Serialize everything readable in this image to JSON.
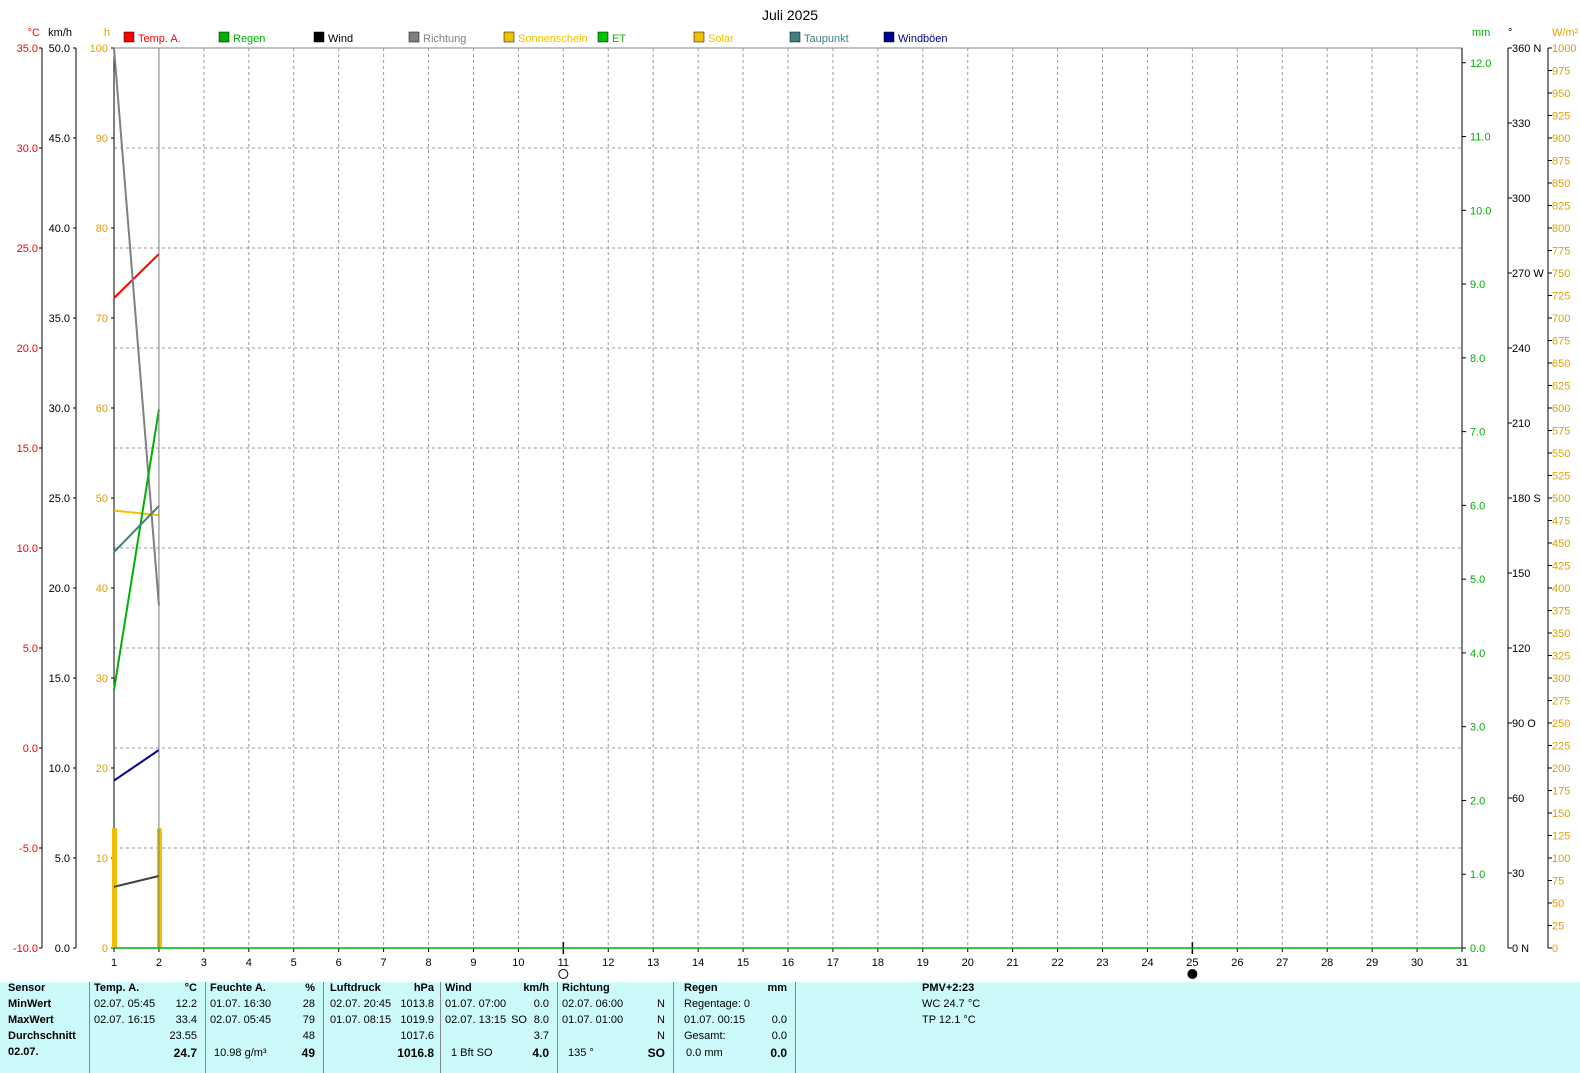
{
  "title": "Juli 2025",
  "units": {
    "temp": "°C",
    "wind": "km/h",
    "hours": "h",
    "rain": "mm",
    "dir": "°",
    "solar": "W/m²"
  },
  "legend": [
    {
      "label": "Temp. A.",
      "color": "#ff0000"
    },
    {
      "label": "Regen",
      "color": "#00b000"
    },
    {
      "label": "Wind",
      "color": "#000000"
    },
    {
      "label": "Richtung",
      "color": "#808080"
    },
    {
      "label": "Sonnenschein",
      "color": "#f0c000"
    },
    {
      "label": "ET",
      "color": "#00c000"
    },
    {
      "label": "Solar",
      "color": "#f0c000"
    },
    {
      "label": "Taupunkt",
      "color": "#408080"
    },
    {
      "label": "Windböen",
      "color": "#000090"
    }
  ],
  "chart_data": {
    "type": "line",
    "title": "Juli 2025",
    "x_ticks": [
      "1",
      "2",
      "3",
      "4",
      "5",
      "6",
      "7",
      "8",
      "9",
      "10",
      "11",
      "12",
      "13",
      "14",
      "15",
      "16",
      "17",
      "18",
      "19",
      "20",
      "21",
      "22",
      "23",
      "24",
      "25",
      "26",
      "27",
      "28",
      "29",
      "30",
      "31"
    ],
    "xlim": [
      1,
      31
    ],
    "grid": true,
    "axes": {
      "temp": {
        "unit": "°C",
        "ylim": [
          -10,
          35
        ],
        "ticks": [
          "35.0",
          "30.0",
          "25.0",
          "20.0",
          "15.0",
          "10.0",
          "5.0",
          "0.0",
          "-5.0",
          "-10.0"
        ],
        "color": "#ff0000"
      },
      "wind": {
        "unit": "km/h",
        "ylim": [
          0,
          50
        ],
        "ticks": [
          "50.0",
          "45.0",
          "40.0",
          "35.0",
          "30.0",
          "25.0",
          "20.0",
          "15.0",
          "10.0",
          "5.0",
          "0.0"
        ],
        "color": "#000000"
      },
      "hours": {
        "unit": "h",
        "ylim": [
          0,
          100
        ],
        "ticks": [
          "100",
          "90",
          "80",
          "70",
          "60",
          "50",
          "40",
          "30",
          "20",
          "10",
          "0"
        ],
        "color": "#e0a000"
      },
      "rain": {
        "unit": "mm",
        "ylim": [
          0,
          12.2
        ],
        "ticks": [
          "12.0",
          "11.0",
          "10.0",
          "9.0",
          "8.0",
          "7.0",
          "6.0",
          "5.0",
          "4.0",
          "3.0",
          "2.0",
          "1.0",
          "0.0"
        ],
        "color": "#00b000"
      },
      "direction": {
        "unit": "°",
        "ylim": [
          0,
          360
        ],
        "ticks": [
          "360 N",
          "330",
          "300",
          "270 W",
          "240",
          "210",
          "180 S",
          "150",
          "120",
          "90 O",
          "60",
          "30",
          "0 N"
        ],
        "color": "#000000"
      },
      "solar": {
        "unit": "W/m²",
        "ylim": [
          0,
          1000
        ],
        "ticks": [
          "1000",
          "975",
          "950",
          "925",
          "900",
          "875",
          "850",
          "825",
          "800",
          "775",
          "750",
          "725",
          "700",
          "675",
          "650",
          "625",
          "600",
          "575",
          "550",
          "525",
          "500",
          "475",
          "450",
          "425",
          "400",
          "375",
          "350",
          "325",
          "300",
          "275",
          "250",
          "225",
          "200",
          "175",
          "150",
          "125",
          "100",
          "75",
          "50",
          "25",
          "0"
        ],
        "color": "#e0a000"
      }
    },
    "series": [
      {
        "name": "Temp. A.",
        "axis": "temp",
        "color": "#ff0000",
        "x": [
          1,
          2
        ],
        "y": [
          22.5,
          24.7
        ]
      },
      {
        "name": "Regen",
        "axis": "rain",
        "color": "#00b000",
        "x": [
          1,
          31
        ],
        "y": [
          0,
          0
        ]
      },
      {
        "name": "Wind",
        "axis": "wind",
        "color": "#404040",
        "x": [
          1,
          2
        ],
        "y": [
          3.4,
          4.0
        ]
      },
      {
        "name": "Richtung",
        "axis": "direction",
        "color": "#808080",
        "x": [
          1,
          2
        ],
        "y": [
          360,
          137
        ]
      },
      {
        "name": "Sonnenschein",
        "axis": "hours",
        "color": "#f0c000",
        "x": [
          1,
          2
        ],
        "y": [
          48.6,
          48.1
        ]
      },
      {
        "name": "ET",
        "axis": "rain",
        "color": "#00b000",
        "x": [
          1,
          2
        ],
        "y": [
          3.5,
          7.3
        ]
      },
      {
        "name": "Taupunkt",
        "axis": "temp",
        "color": "#408080",
        "x": [
          1,
          2
        ],
        "y": [
          9.8,
          12.1
        ]
      },
      {
        "name": "Windböen",
        "axis": "wind",
        "color": "#000090",
        "x": [
          1,
          2
        ],
        "y": [
          9.3,
          11.0
        ]
      }
    ],
    "solar_bars": {
      "axis": "solar",
      "color": "#f0c000",
      "x": [
        1,
        2
      ],
      "y": [
        133,
        133
      ]
    },
    "moon_phases": [
      {
        "x": 11,
        "phase": "full"
      },
      {
        "x": 25,
        "phase": "new"
      }
    ]
  },
  "table": {
    "sensor_col": {
      "header": "Sensor",
      "rows": [
        "MinWert",
        "MaxWert",
        "Durchschnitt",
        "02.07."
      ]
    },
    "temp": {
      "header": "Temp. A.",
      "unit": "°C",
      "min_time": "02.07.  05:45",
      "min_val": "12.2",
      "max_time": "02.07.  16:15",
      "max_val": "33.4",
      "avg": "23.55",
      "current": "24.7"
    },
    "humidity": {
      "header": "Feuchte A.",
      "unit": "%",
      "min_time": "01.07.  16:30",
      "min_val": "28",
      "max_time": "02.07.  05:45",
      "max_val": "79",
      "avg": "48",
      "extra": "10.98 g/m³",
      "current": "49"
    },
    "pressure": {
      "header": "Luftdruck",
      "unit": "hPa",
      "min_time": "02.07.  20:45",
      "min_val": "1013.8",
      "max_time": "01.07.  08:15",
      "max_val": "1019.9",
      "avg": "1017.6",
      "current": "1016.8"
    },
    "wind": {
      "header": "Wind",
      "unit": "km/h",
      "min_time": "01.07.  07:00",
      "min_val": "0.0",
      "max_time": "02.07.  13:15",
      "max_dir": "SO",
      "max_val": "8.0",
      "avg": "3.7",
      "extra": "1 Bft SO",
      "current": "4.0"
    },
    "direction": {
      "header": "Richtung",
      "min_time": "02.07.  06:00",
      "min_val": "N",
      "max_time": "01.07.  01:00",
      "max_val": "N",
      "avg": "N",
      "extra": "135 °",
      "current": "SO"
    },
    "rain": {
      "header": "Regen",
      "unit": "mm",
      "days_label": "Regentage: 0",
      "max_time": "01.07.  00:15",
      "max_val": "0.0",
      "total_label": "Gesamt:",
      "total_val": "0.0",
      "extra": "0.0 mm",
      "current": "0.0"
    },
    "misc": {
      "pmv": "PMV+2:23",
      "wc": "WC 24.7 °C",
      "tp": "TP 12.1 °C"
    }
  }
}
